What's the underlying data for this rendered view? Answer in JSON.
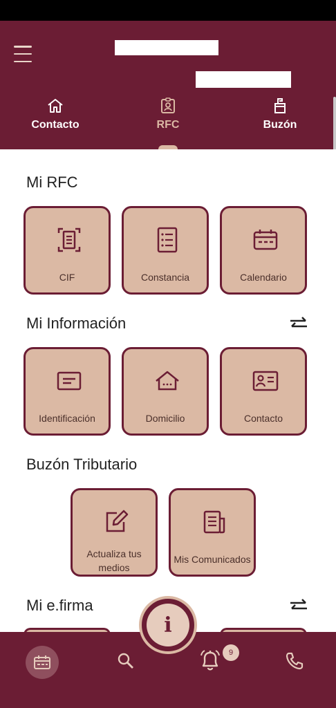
{
  "header": {
    "tabs": [
      {
        "label": "Contacto",
        "icon": "home-icon",
        "active": false
      },
      {
        "label": "RFC",
        "icon": "id-badge-icon",
        "active": true
      },
      {
        "label": "Buzón",
        "icon": "mailbox-icon",
        "active": false
      }
    ]
  },
  "sections": {
    "rfc": {
      "title": "Mi RFC",
      "cards": [
        {
          "label": "CIF",
          "icon": "scan-document-icon"
        },
        {
          "label": "Constancia",
          "icon": "checklist-document-icon"
        },
        {
          "label": "Calendario",
          "icon": "calendar-icon"
        }
      ]
    },
    "info": {
      "title": "Mi Información",
      "cards": [
        {
          "label": "Identificación",
          "icon": "id-card-icon"
        },
        {
          "label": "Domicilio",
          "icon": "house-icon"
        },
        {
          "label": "Contacto",
          "icon": "contact-card-icon"
        }
      ]
    },
    "buzon": {
      "title": "Buzón Tributario",
      "cards": [
        {
          "label": "Actualiza tus medios",
          "icon": "edit-icon"
        },
        {
          "label": "Mis Comunicados",
          "icon": "newspaper-icon"
        }
      ]
    },
    "efirma": {
      "title": "Mi e.firma"
    }
  },
  "bottom_nav": {
    "info_button": "i",
    "notification_count": "9",
    "items": [
      "calendar-icon",
      "search-icon",
      "bell-icon",
      "phone-icon"
    ]
  },
  "colors": {
    "primary": "#6b1d34",
    "accent": "#dbb9a4"
  }
}
